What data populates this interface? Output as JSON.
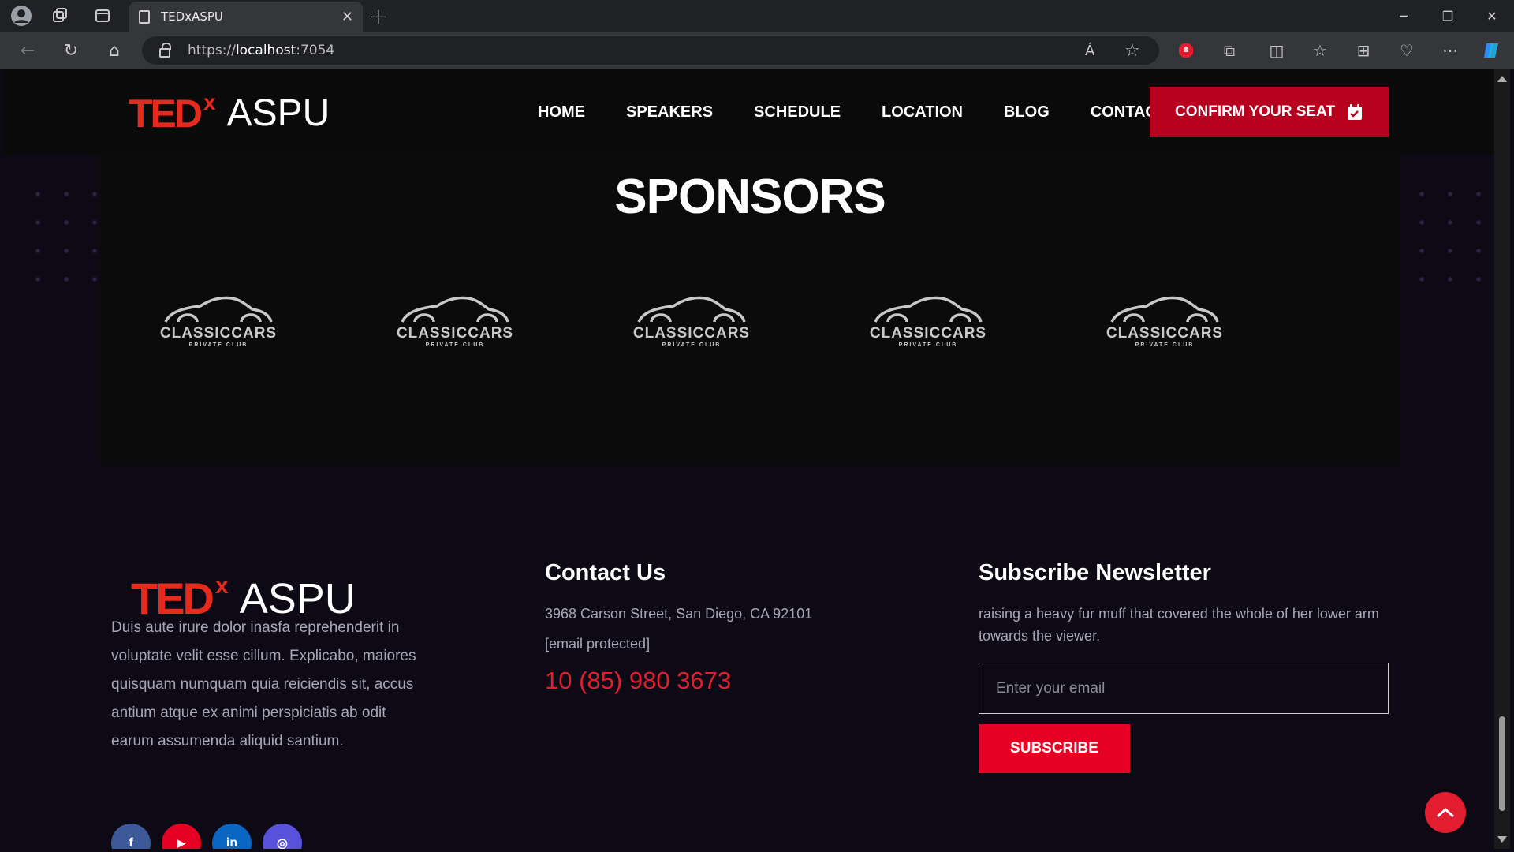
{
  "browser": {
    "tab_title": "TEDxASPU",
    "url_prefix": "https://",
    "url_host": "localhost",
    "url_suffix": ":7054",
    "read_aloud": "Á"
  },
  "site": {
    "logo": {
      "ted": "TED",
      "x": "x",
      "aspu": "ASPU"
    },
    "nav": [
      "HOME",
      "SPEAKERS",
      "SCHEDULE",
      "LOCATION",
      "BLOG",
      "CONTACT"
    ],
    "cta_label": "CONFIRM YOUR SEAT"
  },
  "sponsors": {
    "title": "SPONSORS",
    "logos": [
      {
        "brand": "CLASSICCARS",
        "sub": "PRIVATE CLUB"
      },
      {
        "brand": "CLASSICCARS",
        "sub": "PRIVATE CLUB"
      },
      {
        "brand": "CLASSICCARS",
        "sub": "PRIVATE CLUB"
      },
      {
        "brand": "CLASSICCARS",
        "sub": "PRIVATE CLUB"
      },
      {
        "brand": "CLASSICCARS",
        "sub": "PRIVATE CLUB"
      }
    ]
  },
  "footer": {
    "about": "Duis aute irure dolor inasfa reprehenderit in voluptate velit esse cillum. Explicabo, maiores quisquam numquam quia reiciendis sit, accus antium atque ex animi perspiciatis ab odit earum assumenda aliquid santium.",
    "contact": {
      "title": "Contact Us",
      "address": "3968 Carson Street, San Diego, CA 92101",
      "email": "[email protected]",
      "phone": "10 (85) 980 3673"
    },
    "newsletter": {
      "title": "Subscribe Newsletter",
      "text": "raising a heavy fur muff that covered the whole of her lower arm towards the viewer.",
      "placeholder": "Enter your email",
      "button": "SUBSCRIBE"
    },
    "socials": [
      {
        "icon": "facebook-icon",
        "glyph": "f",
        "color": "#3b5998"
      },
      {
        "icon": "youtube-icon",
        "glyph": "▶",
        "color": "#e60023"
      },
      {
        "icon": "linkedin-icon",
        "glyph": "in",
        "color": "#0a66c2"
      },
      {
        "icon": "instagram-icon",
        "glyph": "◎",
        "color": "#5851db"
      }
    ]
  },
  "colors": {
    "accent": "#e62b1e",
    "cta": "#b8001f",
    "page_bg": "#0d0a15"
  }
}
